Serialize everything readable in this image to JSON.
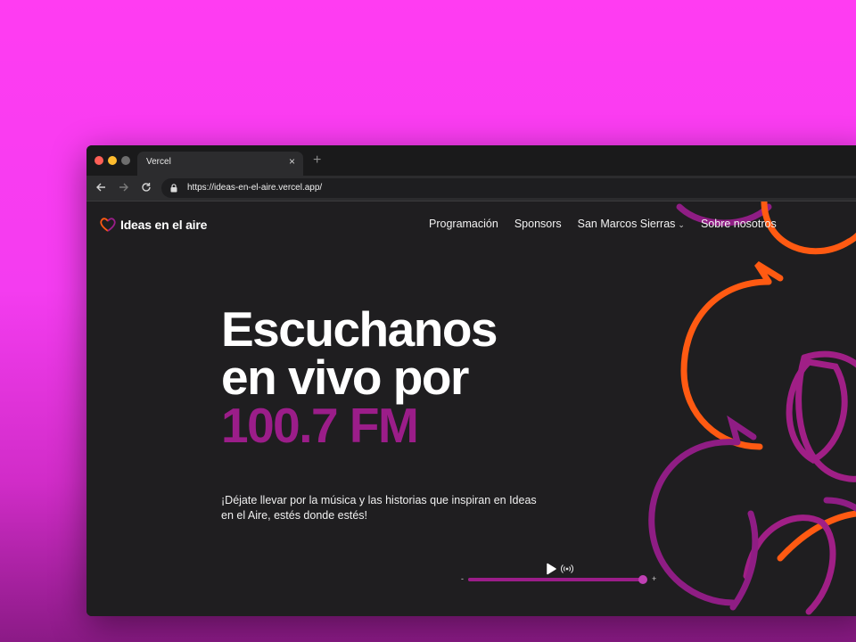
{
  "browser": {
    "tab_title": "Vercel",
    "close_symbol": "×",
    "new_tab_symbol": "+",
    "url": "https://ideas-en-el-aire.vercel.app/"
  },
  "site": {
    "brand": "Ideas en el aire",
    "nav": [
      {
        "label": "Programación"
      },
      {
        "label": "Sponsors"
      },
      {
        "label": "San Marcos Sierras",
        "dropdown": true
      },
      {
        "label": "Sobre nosotros"
      }
    ]
  },
  "hero": {
    "line1": "Escuchanos",
    "line2": "en vivo por",
    "frequency": "100.7 FM",
    "description": "¡Déjate llevar por la música y las historias que inspiran en Ideas en el Aire, estés donde estés!"
  },
  "player": {
    "volume_minus": "-",
    "volume_plus": "+",
    "volume_level": 0.98
  },
  "colors": {
    "accent": "#9b1d89",
    "orange": "#ff5a12",
    "background": "#1f1e20"
  },
  "icons": [
    "lock-icon",
    "back-arrow-icon",
    "forward-arrow-icon",
    "reload-icon",
    "play-icon",
    "broadcast-icon",
    "chevron-down-icon",
    "heart-logo-icon"
  ]
}
